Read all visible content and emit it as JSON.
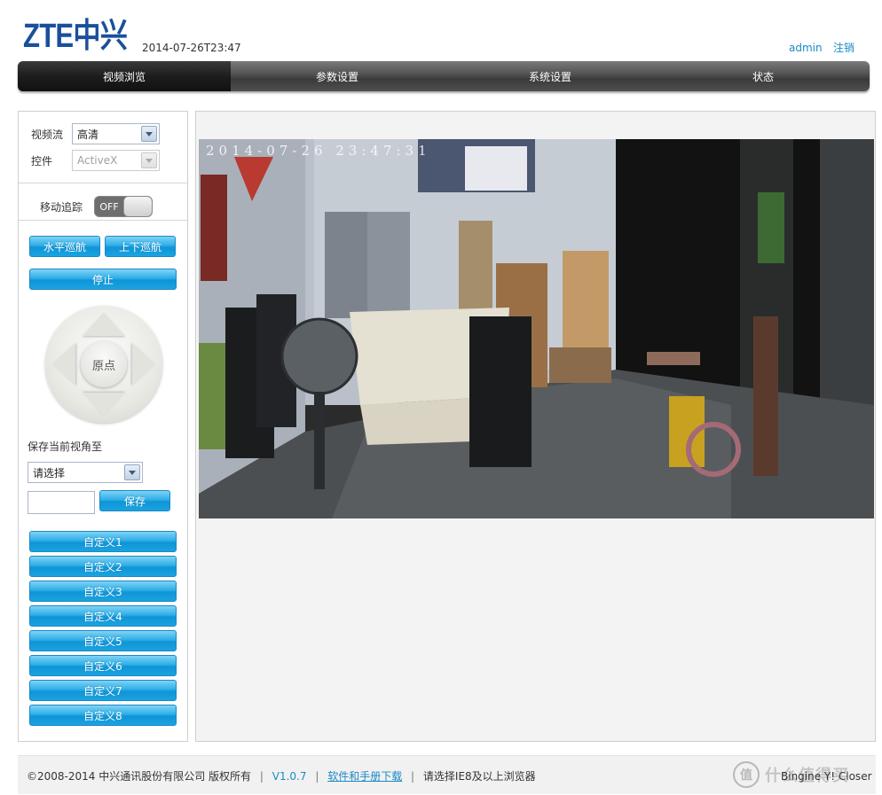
{
  "header": {
    "logo_text": "ZTE中兴",
    "datetime": "2014-07-26T23:47",
    "user": "admin",
    "logout": "注销"
  },
  "nav": {
    "items": [
      "视频浏览",
      "参数设置",
      "系统设置",
      "状态"
    ],
    "active_index": 0
  },
  "left": {
    "stream_label": "视频流",
    "stream_value": "高清",
    "control_label": "控件",
    "control_value": "ActiveX",
    "motion_label": "移动追踪",
    "motion_toggle": "OFF",
    "btn_horizontal": "水平巡航",
    "btn_vertical": "上下巡航",
    "btn_stop": "停止",
    "ptz_home": "原点",
    "save_view_label": "保存当前视角至",
    "preset_select": "请选择",
    "preset_input": "",
    "btn_save": "保存",
    "custom_buttons": [
      "自定义1",
      "自定义2",
      "自定义3",
      "自定义4",
      "自定义5",
      "自定义6",
      "自定义7",
      "自定义8"
    ]
  },
  "video": {
    "osd": "2014-07-26  23:47:31"
  },
  "footer": {
    "copyright": "©2008-2014 中兴通讯股份有限公司 版权所有",
    "version": "V1.0.7",
    "download": "软件和手册下载",
    "browser_note": "请选择IE8及以上浏览器",
    "watermark": "什么值得买",
    "watermark_glyph": "值",
    "watermark_sub": "Bingine Y! Closer"
  },
  "colors": {
    "brand": "#1a4f9c",
    "link": "#1a8ac6",
    "button": "#1aa3e0"
  }
}
